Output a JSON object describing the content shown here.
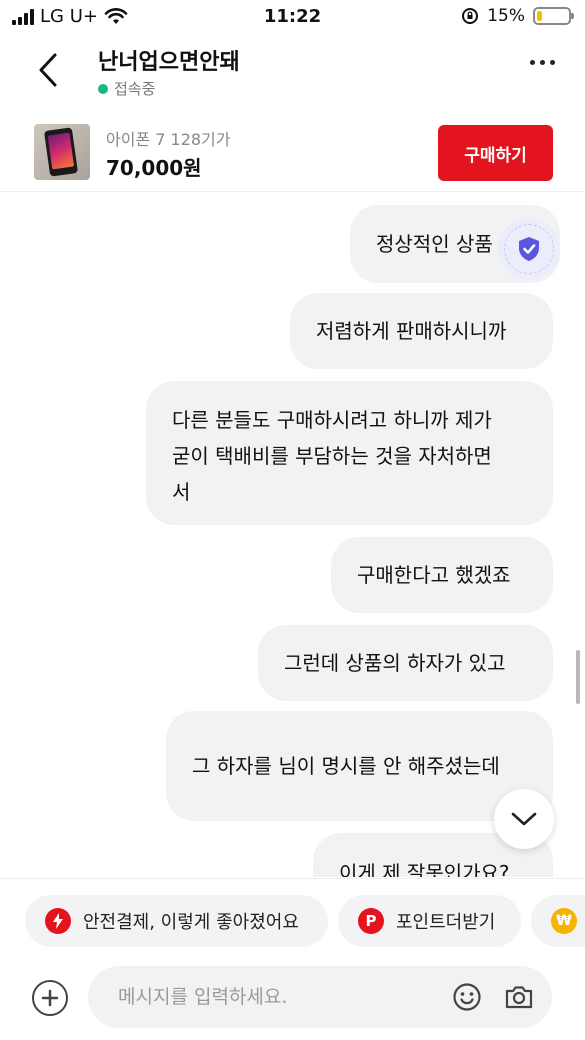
{
  "status_bar": {
    "carrier": "LG U+",
    "time": "11:22",
    "battery": "15%"
  },
  "header": {
    "title": "난너업으면안돼",
    "status": "접속중"
  },
  "product": {
    "name": "아이폰 7 128기가",
    "price": "70,000원",
    "buy_label": "구매하기"
  },
  "messages": [
    {
      "text": "정상적인 상품"
    },
    {
      "text": "저렴하게 판매하시니까"
    },
    {
      "lines": [
        "다른 분들도 구매하시려고 하니까 제가",
        "굳이 택배비를 부담하는 것을 자처하면",
        "서"
      ]
    },
    {
      "text": "구매한다고 했겠죠"
    },
    {
      "text": "그런데 상품의 하자가 있고"
    },
    {
      "text": "그 하자를 님이 명시를 안 해주셨는데"
    },
    {
      "text": "이게 제 잘못인가요?"
    }
  ],
  "chips": [
    {
      "label": "안전결제, 이렇게 좋아졌어요",
      "icon": "lightning-icon",
      "color": "#e3141d"
    },
    {
      "label": "포인트더받기",
      "icon": "point-p-icon",
      "color": "#e3141d"
    },
    {
      "label": "",
      "icon": "won-coin-icon",
      "color": "#f4b400"
    }
  ],
  "input": {
    "placeholder": "메시지를 입력하세요."
  }
}
